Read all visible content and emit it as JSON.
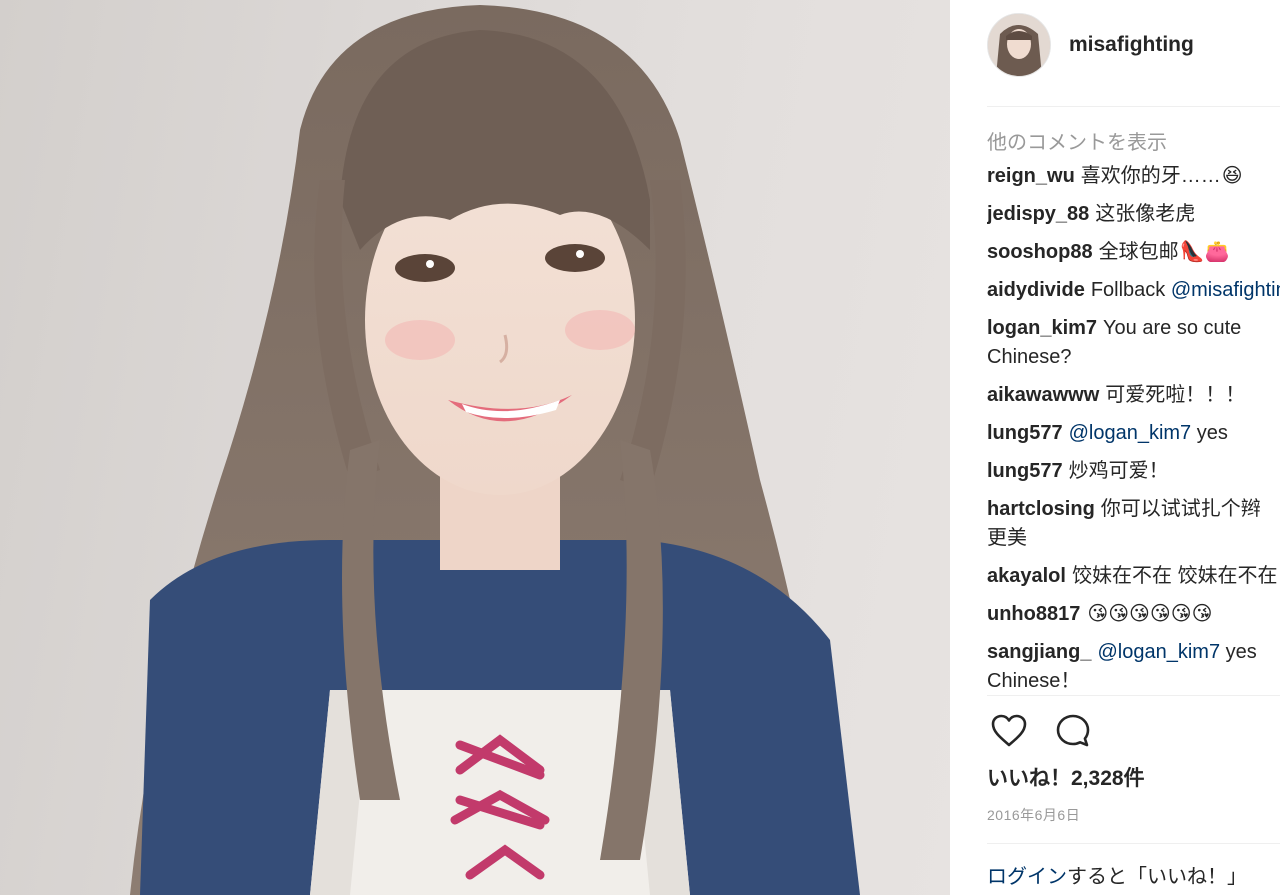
{
  "post": {
    "username": "misafighting",
    "more_comments_label": "他のコメントを表示",
    "likes_text": "いいね！2,328件",
    "date": "2016年6月6日",
    "login_link": "ログイン",
    "login_rest": "すると「いいね！」"
  },
  "comments": [
    {
      "user": "reign_wu",
      "text": "喜欢你的牙……",
      "emoji": "😆"
    },
    {
      "user": "jedispy_88",
      "text": "这张像老虎"
    },
    {
      "user": "sooshop88",
      "text": "全球包邮",
      "emoji": "👠👛"
    },
    {
      "user": "aidydivide",
      "text": "Follback ",
      "mention": "@misafighting"
    },
    {
      "user": "logan_kim7",
      "text": "You are so cute",
      "text2": "Chinese?"
    },
    {
      "user": "aikawawww",
      "text": "可爱死啦！！！"
    },
    {
      "user": "lung577",
      "mention": "@logan_kim7",
      "text_after": " yes"
    },
    {
      "user": "lung577",
      "text": "炒鸡可爱！"
    },
    {
      "user": "hartclosing",
      "text": "你可以试试扎个辫",
      "text2": "更美"
    },
    {
      "user": "akayalol",
      "text": "饺妹在不在 饺妹在不在"
    },
    {
      "user": "unho8817",
      "emoji": "😘😘😘😘😘😘"
    },
    {
      "user": "sangjiang_",
      "mention": "@logan_kim7",
      "text_after": " yes",
      "text2": "Chinese！"
    }
  ],
  "icons": {
    "like": "heart-icon",
    "comment": "comment-bubble-icon"
  },
  "colors": {
    "mention": "#003569",
    "muted": "#999999",
    "text": "#262626"
  }
}
